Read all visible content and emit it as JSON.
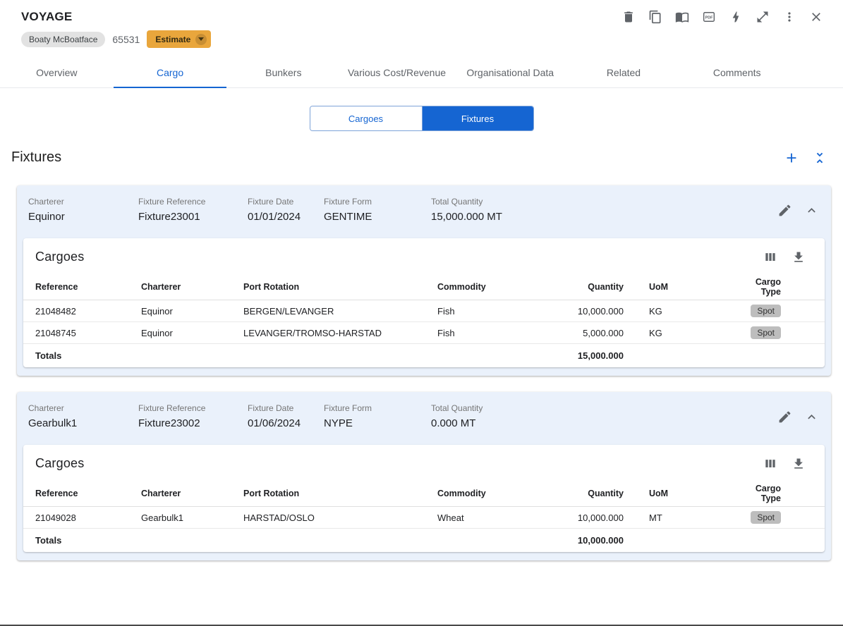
{
  "colors": {
    "accent_blue": "#1565d2",
    "amber": "#e9a63c",
    "fixture_header_bg": "#eaf1fb",
    "chip_gray": "#bdbdbd",
    "icon_gray": "#5f6368"
  },
  "header": {
    "title": "VOYAGE",
    "vessel_name": "Boaty McBoatface",
    "voyage_number": "65531",
    "estimate_label": "Estimate",
    "action_icons": [
      "delete",
      "copy",
      "book",
      "pdf",
      "bolt",
      "expand",
      "more",
      "close"
    ]
  },
  "tabs": [
    {
      "label": "Overview",
      "active": false
    },
    {
      "label": "Cargo",
      "active": true
    },
    {
      "label": "Bunkers",
      "active": false
    },
    {
      "label": "Various Cost/Revenue",
      "active": false
    },
    {
      "label": "Organisational Data",
      "active": false
    },
    {
      "label": "Related",
      "active": false
    },
    {
      "label": "Comments",
      "active": false
    }
  ],
  "view_toggle": [
    {
      "label": "Cargoes",
      "selected": false
    },
    {
      "label": "Fixtures",
      "selected": true
    }
  ],
  "fixtures_section": {
    "title": "Fixtures"
  },
  "cargo_table_headers": [
    "Reference",
    "Charterer",
    "Port Rotation",
    "Commodity",
    "Quantity",
    "UoM",
    "Cargo Type"
  ],
  "fixtures": [
    {
      "fields": [
        {
          "label": "Charterer",
          "value": "Equinor"
        },
        {
          "label": "Fixture Reference",
          "value": "Fixture23001"
        },
        {
          "label": "Fixture Date",
          "value": "01/01/2024"
        },
        {
          "label": "Fixture Form",
          "value": "GENTIME"
        },
        {
          "label": "Total Quantity",
          "value": "15,000.000 MT"
        }
      ],
      "cargoes_title": "Cargoes",
      "rows": [
        [
          "21048482",
          "Equinor",
          "BERGEN/LEVANGER",
          "Fish",
          "10,000.000",
          "KG",
          "Spot"
        ],
        [
          "21048745",
          "Equinor",
          "LEVANGER/TROMSO-HARSTAD",
          "Fish",
          "5,000.000",
          "KG",
          "Spot"
        ]
      ],
      "totals": {
        "label": "Totals",
        "quantity": "15,000.000"
      }
    },
    {
      "fields": [
        {
          "label": "Charterer",
          "value": "Gearbulk1"
        },
        {
          "label": "Fixture Reference",
          "value": "Fixture23002"
        },
        {
          "label": "Fixture Date",
          "value": "01/06/2024"
        },
        {
          "label": "Fixture Form",
          "value": "NYPE"
        },
        {
          "label": "Total Quantity",
          "value": "0.000 MT"
        }
      ],
      "cargoes_title": "Cargoes",
      "rows": [
        [
          "21049028",
          "Gearbulk1",
          "HARSTAD/OSLO",
          "Wheat",
          "10,000.000",
          "MT",
          "Spot"
        ]
      ],
      "totals": {
        "label": "Totals",
        "quantity": "10,000.000"
      }
    }
  ]
}
